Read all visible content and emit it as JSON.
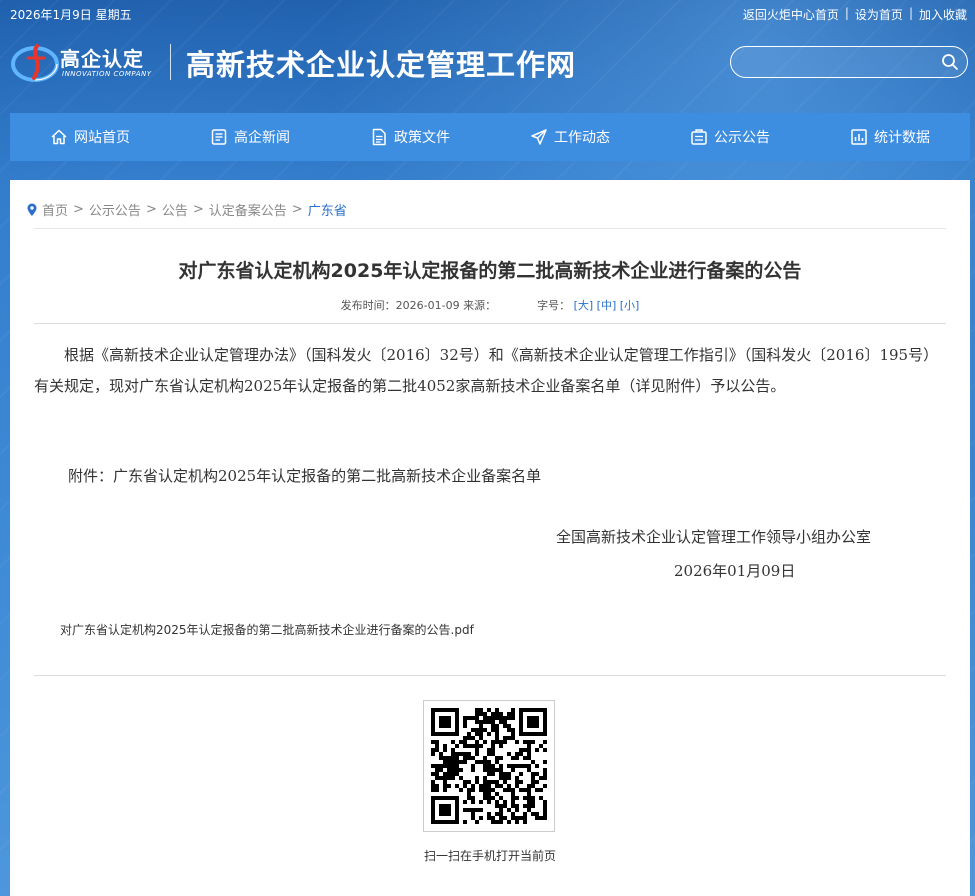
{
  "topbar": {
    "date": "2026年1月9日 星期五",
    "links": [
      "返回火炬中心首页",
      "设为首页",
      "加入收藏"
    ]
  },
  "header": {
    "logo_cn": "高企认定",
    "logo_en": "INNOVATION COMPANY",
    "site_title": "高新技术企业认定管理工作网",
    "search_placeholder": ""
  },
  "nav": [
    {
      "label": "网站首页",
      "icon": "home-icon"
    },
    {
      "label": "高企新闻",
      "icon": "news-icon"
    },
    {
      "label": "政策文件",
      "icon": "document-icon"
    },
    {
      "label": "工作动态",
      "icon": "send-icon"
    },
    {
      "label": "公示公告",
      "icon": "notice-icon"
    },
    {
      "label": "统计数据",
      "icon": "chart-icon"
    }
  ],
  "breadcrumb": {
    "items": [
      "首页",
      "公示公告",
      "公告",
      "认定备案公告"
    ],
    "current": "广东省"
  },
  "article": {
    "title": "对广东省认定机构2025年认定报备的第二批高新技术企业进行备案的公告",
    "meta_publish": "发布时间：2026-01-09 来源：",
    "meta_font": "字号：",
    "font_large": "[大]",
    "font_medium": "[中]",
    "font_small": "[小]",
    "paragraph": "根据《高新技术企业认定管理办法》（国科发火〔2016〕32号）和《高新技术企业认定管理工作指引》（国科发火〔2016〕195号）有关规定，现对广东省认定机构2025年认定报备的第二批4052家高新技术企业备案名单（详见附件）予以公告。",
    "attachment": "附件：广东省认定机构2025年认定报备的第二批高新技术企业备案名单",
    "signature": "全国高新技术企业认定管理工作领导小组办公室",
    "sign_date": "2026年01月09日",
    "pdf_link": "对广东省认定机构2025年认定报备的第二批高新技术企业进行备案的公告.pdf",
    "qr_caption": "扫一扫在手机打开当前页"
  },
  "colors": {
    "header_bg": "#1d5fa8",
    "nav_bg": "#3d8ee0",
    "link_blue": "#2a70c8"
  }
}
